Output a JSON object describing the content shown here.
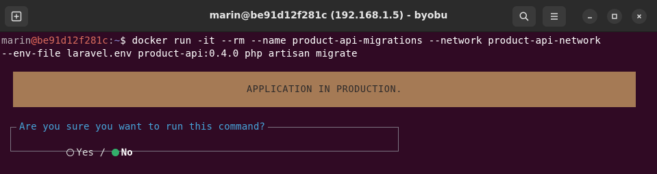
{
  "window": {
    "title": "marin@be91d12f281c (192.168.1.5) - byobu",
    "icons": {
      "new_tab": "new-tab-icon",
      "search": "search-icon",
      "menu": "hamburger-menu-icon",
      "minimize": "minimize-icon",
      "maximize": "maximize-icon",
      "close": "close-icon"
    }
  },
  "terminal": {
    "prompt": {
      "user": "marin",
      "at": "@",
      "host": "be91d12f281c",
      "colon": ":",
      "path": "~",
      "symbol": "$"
    },
    "command_line1": " docker run -it --rm --name product-api-migrations --network product-api-network",
    "command_line2": "--env-file laravel.env product-api:0.4.0 php artisan migrate",
    "banner": "APPLICATION IN PRODUCTION.",
    "question": "Are you sure you want to run this command?",
    "options": {
      "yes": "Yes",
      "separator": " / ",
      "no": "No",
      "selected": "No"
    }
  },
  "colors": {
    "background": "#300a24",
    "titlebar": "#2b2b2b",
    "banner": "#a57a55",
    "question": "#46a3d8",
    "selected_radio": "#33b06b"
  }
}
